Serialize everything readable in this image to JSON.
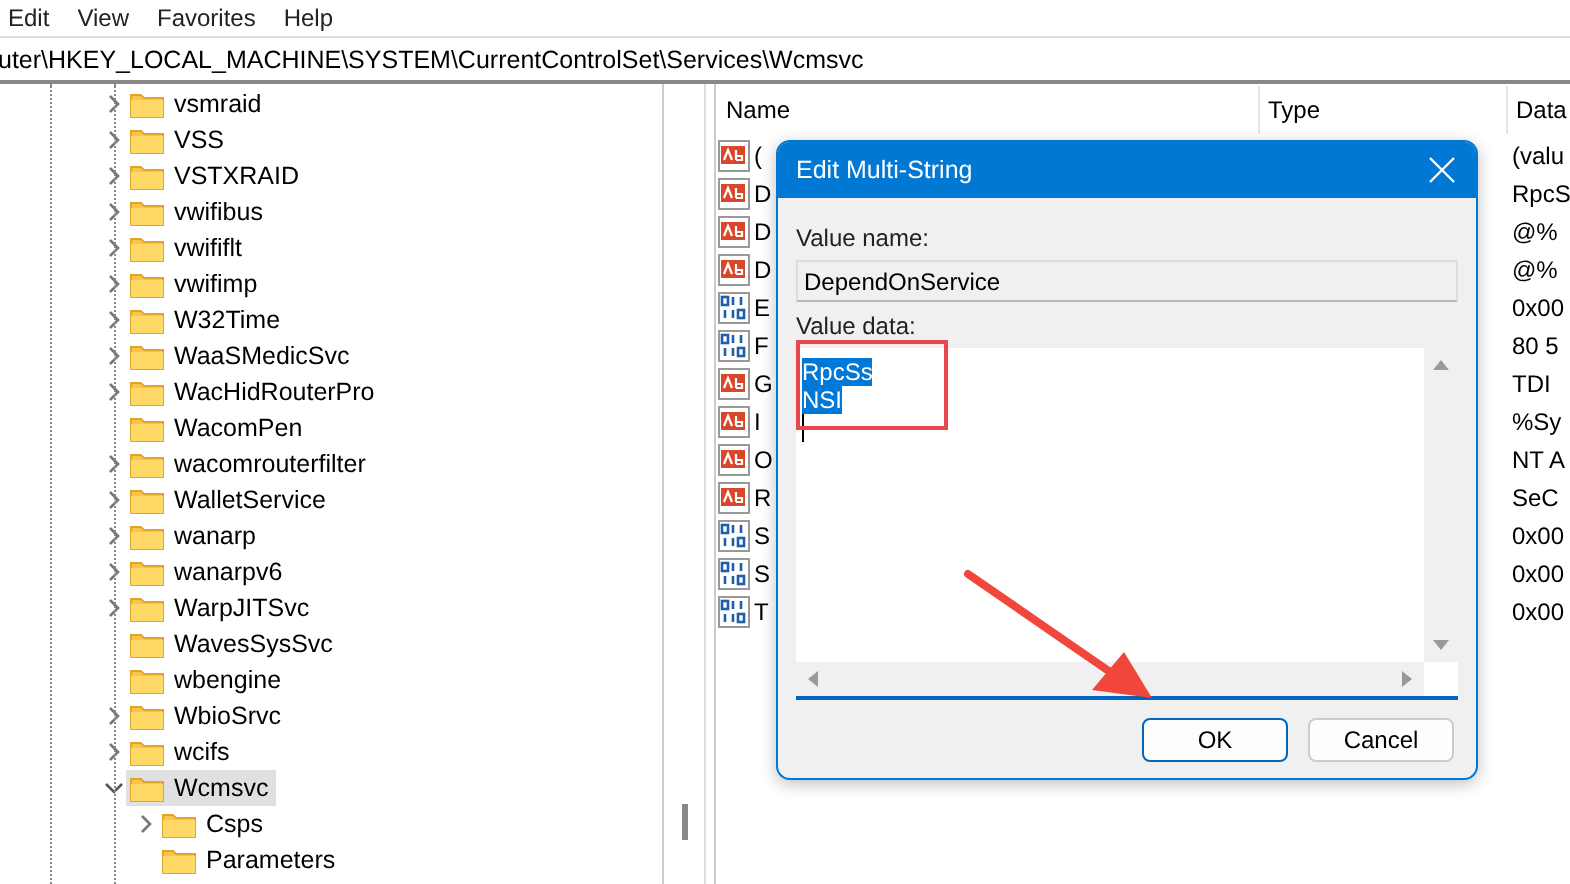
{
  "menu": [
    "Edit",
    "View",
    "Favorites",
    "Help"
  ],
  "address": "uter\\HKEY_LOCAL_MACHINE\\SYSTEM\\CurrentControlSet\\Services\\Wcmsvc",
  "tree": [
    {
      "label": "vsmraid",
      "expandable": true,
      "expanded": false,
      "selected": false
    },
    {
      "label": "VSS",
      "expandable": true,
      "expanded": false,
      "selected": false
    },
    {
      "label": "VSTXRAID",
      "expandable": true,
      "expanded": false,
      "selected": false
    },
    {
      "label": "vwifibus",
      "expandable": true,
      "expanded": false,
      "selected": false
    },
    {
      "label": "vwififlt",
      "expandable": true,
      "expanded": false,
      "selected": false
    },
    {
      "label": "vwifimp",
      "expandable": true,
      "expanded": false,
      "selected": false
    },
    {
      "label": "W32Time",
      "expandable": true,
      "expanded": false,
      "selected": false
    },
    {
      "label": "WaaSMedicSvc",
      "expandable": true,
      "expanded": false,
      "selected": false
    },
    {
      "label": "WacHidRouterPro",
      "expandable": true,
      "expanded": false,
      "selected": false
    },
    {
      "label": "WacomPen",
      "expandable": false,
      "selected": false
    },
    {
      "label": "wacomrouterfilter",
      "expandable": true,
      "expanded": false,
      "selected": false
    },
    {
      "label": "WalletService",
      "expandable": true,
      "expanded": false,
      "selected": false
    },
    {
      "label": "wanarp",
      "expandable": true,
      "expanded": false,
      "selected": false
    },
    {
      "label": "wanarpv6",
      "expandable": true,
      "expanded": false,
      "selected": false
    },
    {
      "label": "WarpJITSvc",
      "expandable": true,
      "expanded": false,
      "selected": false
    },
    {
      "label": "WavesSysSvc",
      "expandable": false,
      "selected": false
    },
    {
      "label": "wbengine",
      "expandable": false,
      "selected": false
    },
    {
      "label": "WbioSrvc",
      "expandable": true,
      "expanded": false,
      "selected": false
    },
    {
      "label": "wcifs",
      "expandable": true,
      "expanded": false,
      "selected": false
    },
    {
      "label": "Wcmsvc",
      "expandable": true,
      "expanded": true,
      "selected": true,
      "children": [
        {
          "label": "Csps",
          "expandable": true,
          "expanded": false,
          "selected": false
        },
        {
          "label": "Parameters",
          "expandable": false,
          "selected": false
        }
      ]
    }
  ],
  "list": {
    "columns": [
      "Name",
      "Type",
      "Data"
    ],
    "rows": [
      {
        "kind": "string",
        "name": "(",
        "data": "(valu"
      },
      {
        "kind": "string",
        "name": "D",
        "data": "RpcS"
      },
      {
        "kind": "string",
        "name": "D",
        "data": "@%"
      },
      {
        "kind": "string",
        "name": "D",
        "data": "@%"
      },
      {
        "kind": "binary",
        "name": "E",
        "data": "0x00"
      },
      {
        "kind": "binary",
        "name": "F",
        "data": "80 5"
      },
      {
        "kind": "string",
        "name": "G",
        "data": "TDI"
      },
      {
        "kind": "string",
        "name": "I",
        "data": "%Sy"
      },
      {
        "kind": "string",
        "name": "O",
        "data": "NT A"
      },
      {
        "kind": "string",
        "name": "R",
        "data": "SeC"
      },
      {
        "kind": "binary",
        "name": "S",
        "data": "0x00"
      },
      {
        "kind": "binary",
        "name": "S",
        "data": "0x00"
      },
      {
        "kind": "binary",
        "name": "T",
        "data": "0x00"
      }
    ]
  },
  "dialog": {
    "title": "Edit Multi-String",
    "value_name_label": "Value name:",
    "value_name": "DependOnService",
    "value_data_label": "Value data:",
    "value_data_lines": [
      "RpcSs",
      "NSI"
    ],
    "buttons": [
      {
        "label": "OK",
        "default": true
      },
      {
        "label": "Cancel",
        "default": false
      }
    ]
  }
}
